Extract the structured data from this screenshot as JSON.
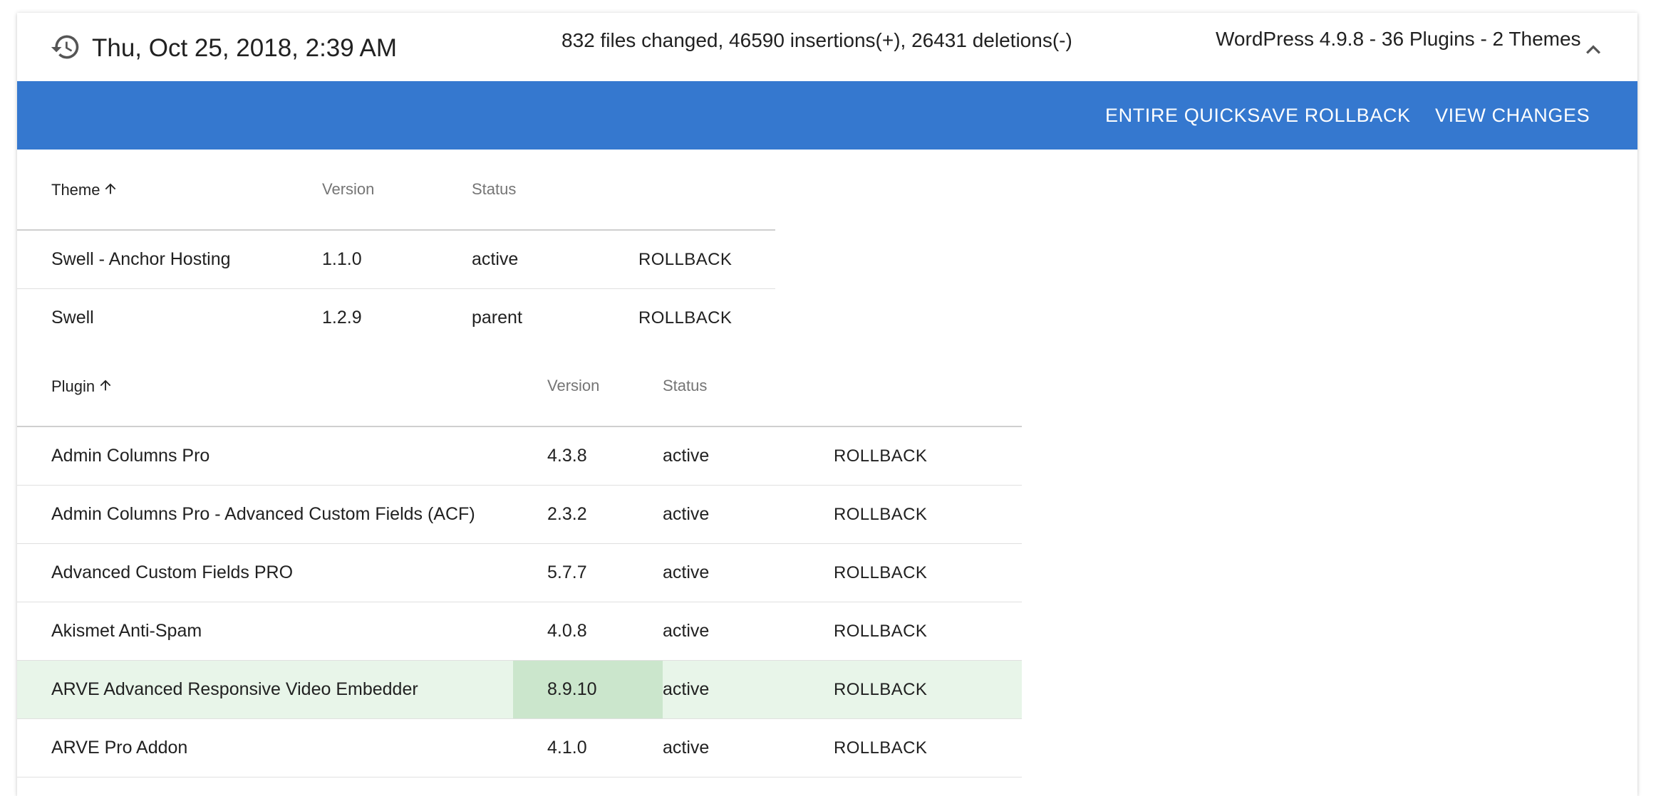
{
  "header": {
    "icon": "history-icon",
    "date": "Thu, Oct 25, 2018, 2:39 AM",
    "stats": "832 files changed, 46590 insertions(+), 26431 deletions(-)",
    "wp_summary": "WordPress 4.9.8 - 36 Plugins - 2 Themes",
    "collapse_icon": "chevron-up-icon"
  },
  "toolbar": {
    "entire_rollback": "ENTIRE QUICKSAVE ROLLBACK",
    "view_changes": "VIEW CHANGES",
    "background": "#3578cf"
  },
  "themes": {
    "columns": {
      "name": "Theme",
      "version": "Version",
      "status": "Status"
    },
    "rows": [
      {
        "name": "Swell - Anchor Hosting",
        "version": "1.1.0",
        "status": "active",
        "action": "ROLLBACK"
      },
      {
        "name": "Swell",
        "version": "1.2.9",
        "status": "parent",
        "action": "ROLLBACK"
      }
    ]
  },
  "plugins": {
    "columns": {
      "name": "Plugin",
      "version": "Version",
      "status": "Status"
    },
    "rows": [
      {
        "name": "Admin Columns Pro",
        "version": "4.3.8",
        "status": "active",
        "action": "ROLLBACK"
      },
      {
        "name": "Admin Columns Pro - Advanced Custom Fields (ACF)",
        "version": "2.3.2",
        "status": "active",
        "action": "ROLLBACK"
      },
      {
        "name": "Advanced Custom Fields PRO",
        "version": "5.7.7",
        "status": "active",
        "action": "ROLLBACK"
      },
      {
        "name": "Akismet Anti-Spam",
        "version": "4.0.8",
        "status": "active",
        "action": "ROLLBACK"
      },
      {
        "name": "ARVE Advanced Responsive Video Embedder",
        "version": "8.9.10",
        "status": "active",
        "action": "ROLLBACK",
        "highlighted": true
      },
      {
        "name": "ARVE Pro Addon",
        "version": "4.1.0",
        "status": "active",
        "action": "ROLLBACK"
      }
    ]
  },
  "colors": {
    "highlight_row": "#e8f5e9",
    "highlight_cell": "#cbe6cc"
  }
}
